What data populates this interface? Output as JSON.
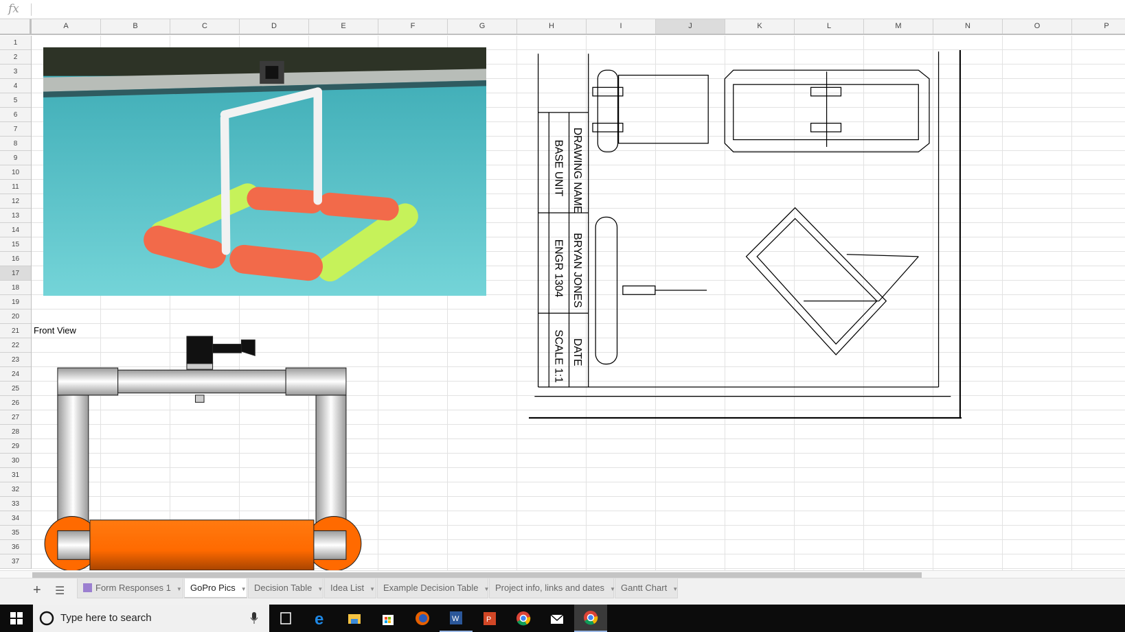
{
  "formula_bar": {
    "fx_label": "fx",
    "value": ""
  },
  "columns": [
    "A",
    "B",
    "C",
    "D",
    "E",
    "F",
    "G",
    "H",
    "I",
    "J",
    "K",
    "L",
    "M",
    "N",
    "O",
    "P"
  ],
  "selected_column": "J",
  "rows": 37,
  "selected_row": 17,
  "cells": {
    "A21": "Front View"
  },
  "drawing": {
    "labels": {
      "drawing_name_label": "DRAWING NAME",
      "drawing_name": "BASE UNIT",
      "author": "BRYAN JONES",
      "course": "ENGR 1304",
      "date_label": "DATE",
      "scale": "SCALE 1:1"
    }
  },
  "sheet_tabs": [
    {
      "label": "Form Responses 1",
      "icon": "form-icon",
      "active": false
    },
    {
      "label": "GoPro Pics",
      "active": true
    },
    {
      "label": "Decision Table",
      "active": false
    },
    {
      "label": "Idea List",
      "active": false
    },
    {
      "label": "Example Decision Table",
      "active": false
    },
    {
      "label": "Project info, links and dates",
      "active": false
    },
    {
      "label": "Gantt Chart",
      "active": false
    }
  ],
  "taskbar": {
    "search_placeholder": "Type here to search",
    "apps": [
      "task-view-icon",
      "edge-icon",
      "file-explorer-icon",
      "store-icon",
      "firefox-icon",
      "word-icon",
      "powerpoint-icon",
      "chrome-icon",
      "mail-icon",
      "chrome-active-icon"
    ]
  },
  "colors": {
    "accent_orange": "#ff6a00",
    "noodle_green": "#c8f55a",
    "water": "#4fc3c8",
    "form_icon": "#9b7fd0"
  }
}
